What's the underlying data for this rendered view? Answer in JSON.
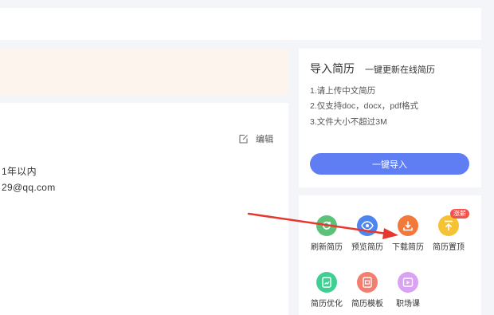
{
  "info": {
    "edit_label": "编辑",
    "line1": "1年以内",
    "line2": "29@qq.com"
  },
  "import_panel": {
    "title": "导入简历",
    "subtitle": "一键更新在线简历",
    "rules": [
      "1.请上传中文简历",
      "2.仅支持doc，docx，pdf格式",
      "3.文件大小不超过3M"
    ],
    "button_label": "一键导入"
  },
  "tools": {
    "items": [
      {
        "label": "刷新简历",
        "icon": "refresh-icon",
        "color": "#5cc27a"
      },
      {
        "label": "预览简历",
        "icon": "eye-icon",
        "color": "#4d86ee"
      },
      {
        "label": "下载简历",
        "icon": "download-icon",
        "color": "#f3793b"
      },
      {
        "label": "简历置顶",
        "icon": "pin-top-icon",
        "color": "#f5c233"
      },
      {
        "label": "简历优化",
        "icon": "optimize-icon",
        "color": "#3fcf93"
      },
      {
        "label": "简历模板",
        "icon": "template-icon",
        "color": "#f37d6f"
      },
      {
        "label": "职场课",
        "icon": "course-icon",
        "color": "#d9a2f2"
      }
    ],
    "badge_label": "涨薪"
  },
  "colors": {
    "accent_blue": "#5f7ef4",
    "notice_bg": "#fdf4ee",
    "arrow_red": "#e8372c"
  }
}
